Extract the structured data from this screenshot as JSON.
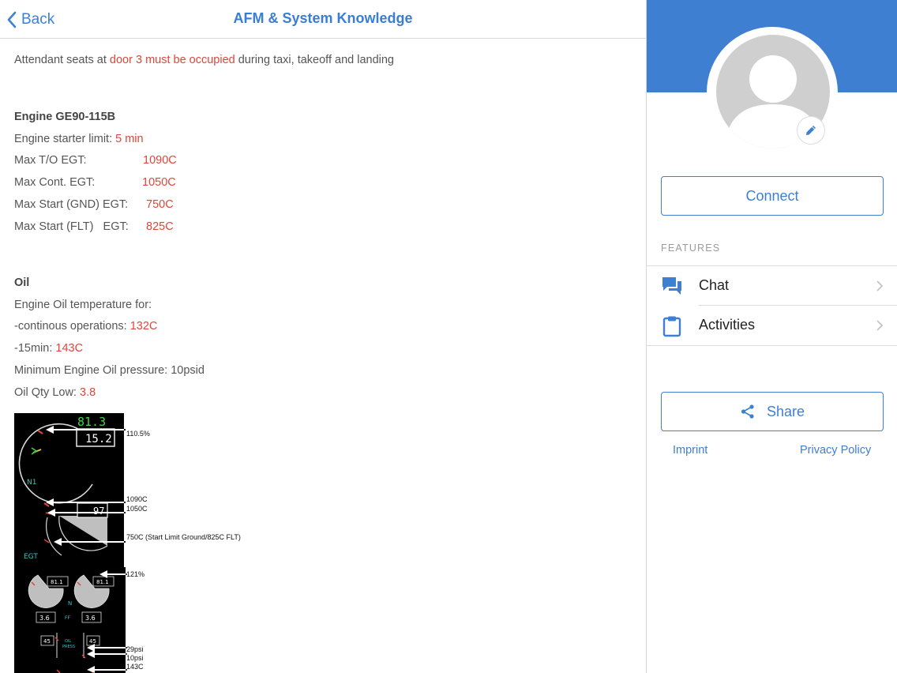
{
  "nav": {
    "back_label": "Back",
    "title": "AFM & System Knowledge"
  },
  "content": {
    "attendant": {
      "prefix": "Attendant seats at ",
      "highlight": "door 3 must be occupied",
      "suffix": " during taxi, takeoff and landing"
    },
    "engine": {
      "heading": "Engine GE90-115B",
      "starter_label": "Engine starter limit: ",
      "starter_value": "5 min",
      "limits": [
        {
          "label": "Max T/O EGT:",
          "value": "1090C"
        },
        {
          "label": "Max Cont. EGT:",
          "value": "1050C"
        },
        {
          "label": "Max Start (GND) EGT:",
          "value": "750C"
        },
        {
          "label": "Max Start (FLT)   EGT:",
          "value": "825C"
        }
      ]
    },
    "oil": {
      "heading": "Oil",
      "temp_intro": "Engine Oil temperature for:",
      "continuous_label": "-continous operations: ",
      "continuous_value": "132C",
      "min15_label": "-15min: ",
      "min15_value": "143C",
      "min_pressure": "Minimum Engine Oil pressure: 10psid",
      "qty_label": "Oil Qty Low: ",
      "qty_value": "3.8"
    }
  },
  "diagram": {
    "n1_readout": "81.3",
    "n1_box": "15.2",
    "n1_label": "N1",
    "egt_box": "97",
    "egt_label": "EGT",
    "small_n1_left": "81.1",
    "small_n1_right": "81.1",
    "small_n_label": "N",
    "qty_left": "3.6",
    "qty_right": "3.6",
    "qty_label": "FF",
    "press_left": "45",
    "press_right": "45",
    "press_label_1": "OIL",
    "press_label_2": "PRESS",
    "annotations": {
      "n1_max": "110.5%",
      "egt_to": "1090C",
      "egt_cont": "1050C",
      "egt_start": "750C (Start Limit Ground/825C FLT)",
      "n2_max": "121%",
      "psi_1": "29psi",
      "psi_2": "10psi",
      "temp": "143C"
    }
  },
  "sidebar": {
    "connect_label": "Connect",
    "features_label": "FEATURES",
    "items": [
      {
        "label": "Chat",
        "icon": "chat-icon"
      },
      {
        "label": "Activities",
        "icon": "clipboard-icon"
      }
    ],
    "share_label": "Share",
    "imprint_label": "Imprint",
    "privacy_label": "Privacy Policy"
  },
  "colors": {
    "accent": "#3e7fd1",
    "highlight": "#e0453a"
  }
}
